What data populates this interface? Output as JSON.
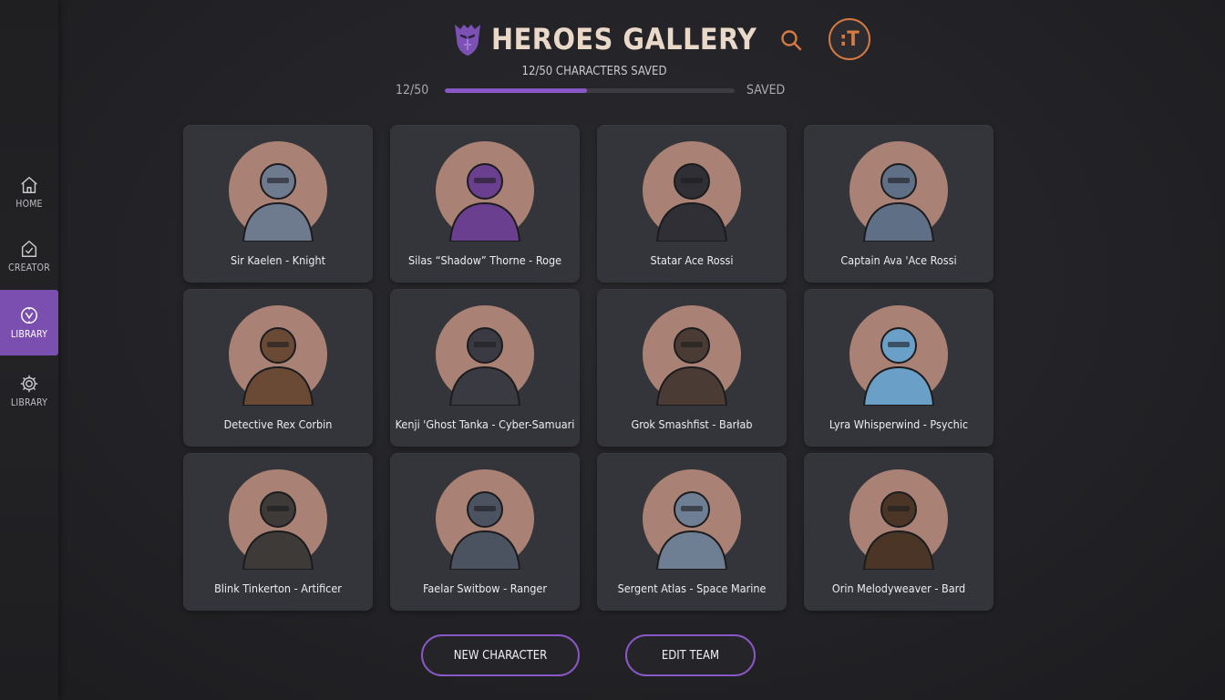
{
  "app": {
    "title": "HEROES GALLERY"
  },
  "sidebar": {
    "items": [
      {
        "label": "HOME",
        "icon": "home-icon",
        "active": false
      },
      {
        "label": "CREATOR",
        "icon": "creator-icon",
        "active": false
      },
      {
        "label": "LIBRARY",
        "icon": "library-icon",
        "active": true
      },
      {
        "label": "LIBRARY",
        "icon": "gear-icon",
        "active": false
      }
    ]
  },
  "header": {
    "search_icon": "search-icon",
    "avatar_letter": ":T"
  },
  "progress": {
    "caption": "12/50 CHARACTERS SAVED",
    "count": "12/50",
    "status": "SAVED",
    "fraction": 0.49
  },
  "characters": [
    {
      "name": "Sir Kaelen - Knight",
      "icon": "knight-icon"
    },
    {
      "name": "Silas “Shadow” Thorne - Roge",
      "icon": "mage-icon"
    },
    {
      "name": "Statar Ace Rossi",
      "icon": "hooded-rogue-icon"
    },
    {
      "name": "Captain Ava 'Ace Rossi",
      "icon": "armored-soldier-icon"
    },
    {
      "name": "Detective Rex Corbin",
      "icon": "detective-icon"
    },
    {
      "name": "Kenji 'Ghost Tanka - Cyber-Samuari",
      "icon": "samurai-icon"
    },
    {
      "name": "Grok Smashfist - Barłab",
      "icon": "barbarian-icon"
    },
    {
      "name": "Lyra Whisperwind - Psychic",
      "icon": "psychic-icon"
    },
    {
      "name": "Blink Tinkerton - Artificer",
      "icon": "artificer-icon"
    },
    {
      "name": "Faelar Switbow - Ranger",
      "icon": "ranger-icon"
    },
    {
      "name": "Sergent Atlas - Space Marine",
      "icon": "space-marine-icon"
    },
    {
      "name": "Orin Melodyweaver - Bard",
      "icon": "bard-icon"
    }
  ],
  "actions": {
    "new_label": "NEW CHARACTER",
    "edit_label": "EDIT TEAM"
  },
  "colors": {
    "accent": "#8a58c6",
    "avatar_ring": "#d57a40",
    "card_bg": "#34353a",
    "portrait_bg": "#b68b7c"
  }
}
